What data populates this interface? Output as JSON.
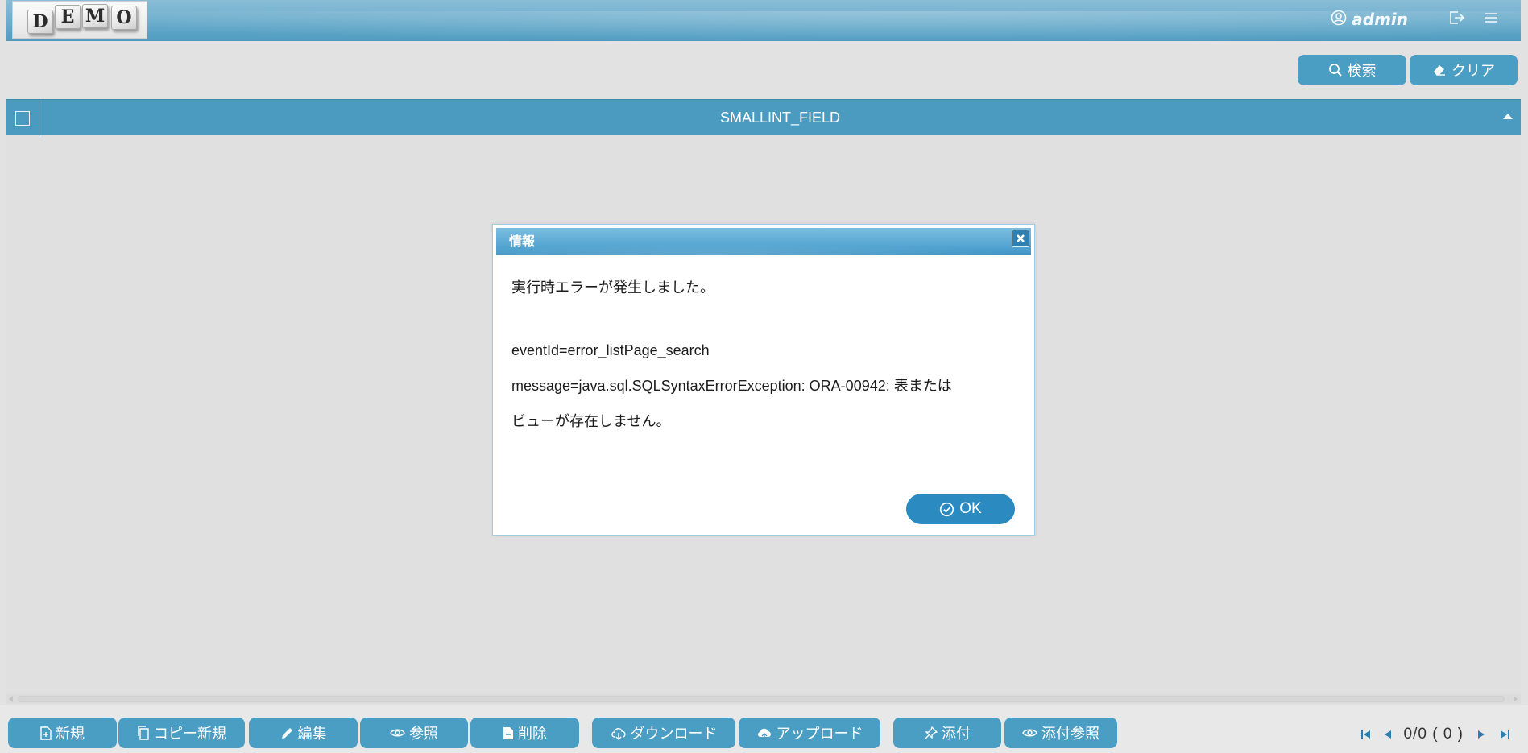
{
  "header": {
    "logo_letters": [
      "D",
      "E",
      "M",
      "O"
    ],
    "username": "admin",
    "icons": [
      "user-circle-icon",
      "logout-icon",
      "menu-icon"
    ]
  },
  "search": {
    "search_label": "検索",
    "clear_label": "クリア"
  },
  "grid": {
    "columns": [
      "SMALLINT_FIELD"
    ],
    "rows": []
  },
  "dialog": {
    "title": "情報",
    "message_line1": "実行時エラーが発生しました。",
    "event_line": "eventId=error_listPage_search",
    "message_line2": "message=java.sql.SQLSyntaxErrorException: ORA-00942: 表または",
    "message_line3": "ビューが存在しません。",
    "ok_label": "OK"
  },
  "toolbar": {
    "new_label": "新規",
    "copy_new_label": "コピー新規",
    "edit_label": "編集",
    "view_label": "参照",
    "delete_label": "削除",
    "download_label": "ダウンロード",
    "upload_label": "アップロード",
    "attach_label": "添付",
    "attach_view_label": "添付参照"
  },
  "pager": {
    "text": "0/0 ( 0 )"
  },
  "colors": {
    "accent": "#4a9ec4",
    "dialog_ok": "#2b8ac0",
    "background": "#e2e2e2"
  }
}
